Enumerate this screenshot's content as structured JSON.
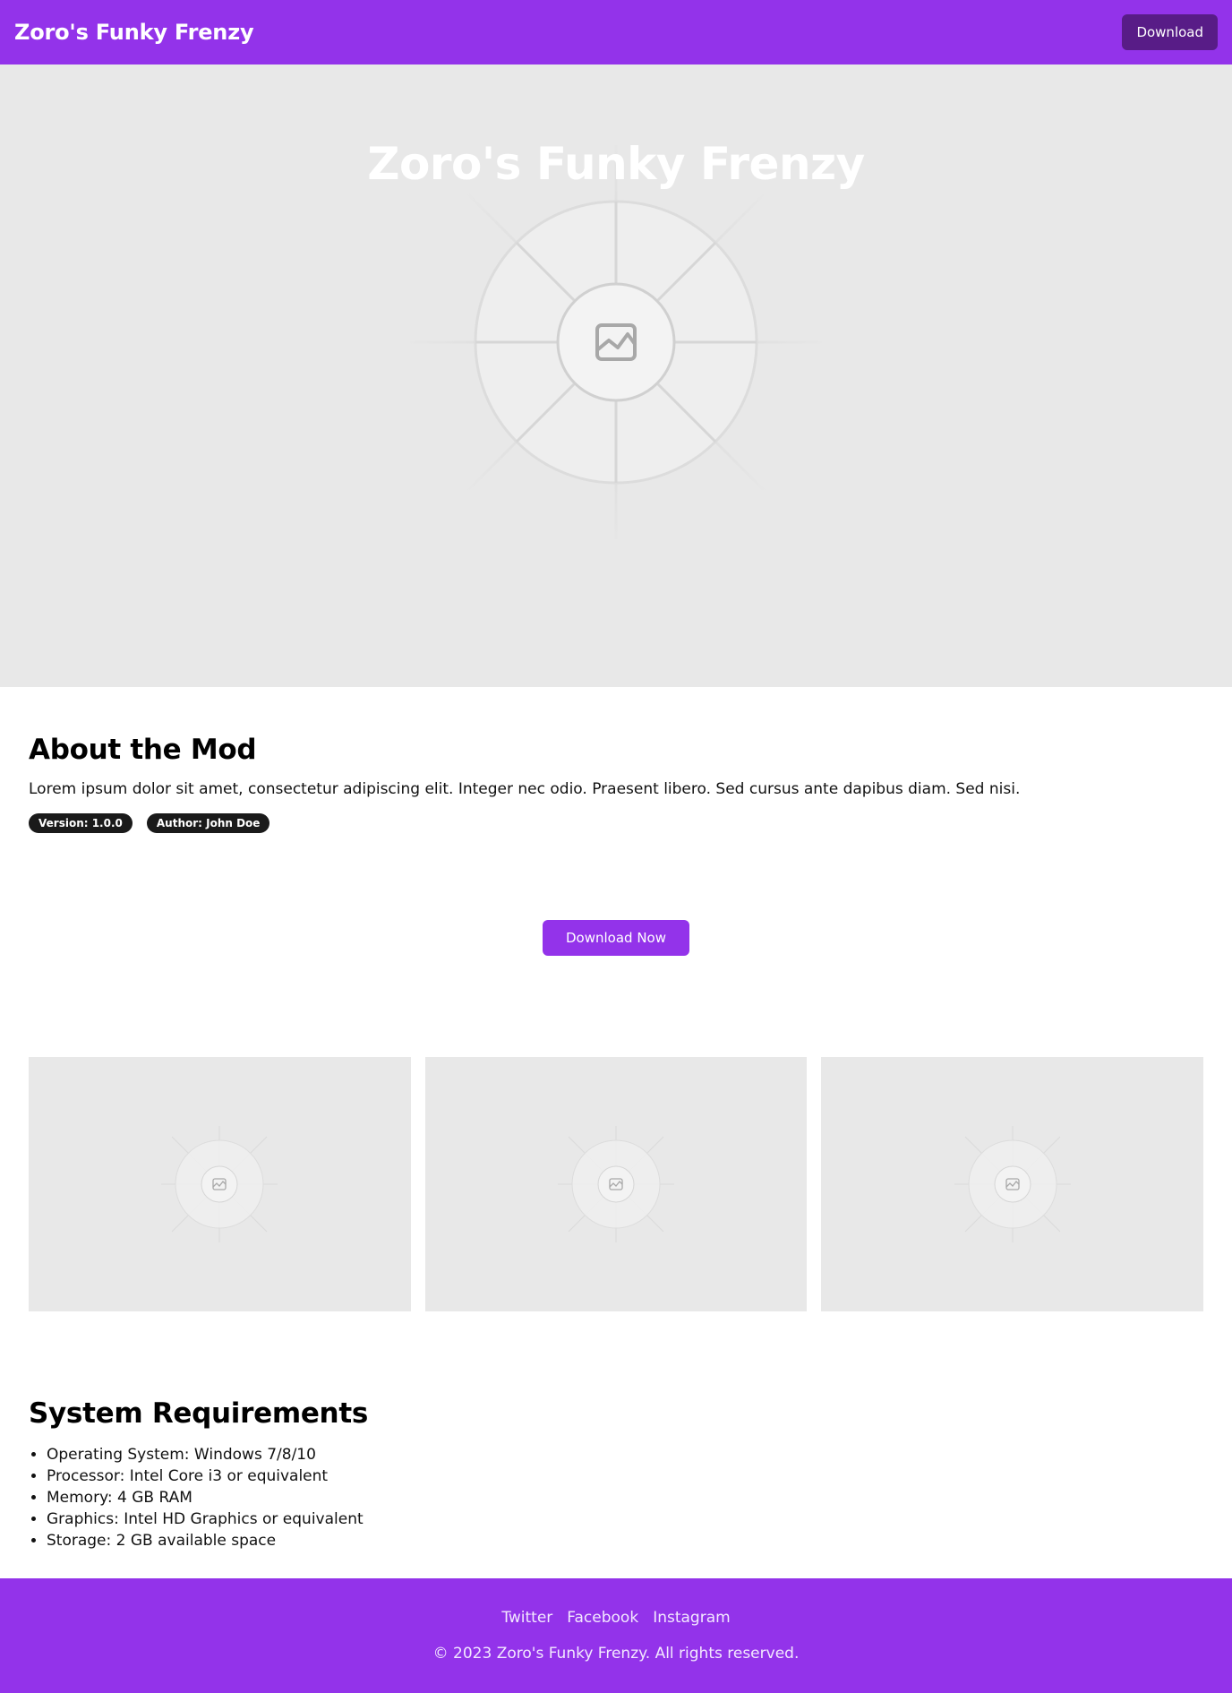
{
  "header": {
    "brand": "Zoro's Funky Frenzy",
    "download_label": "Download"
  },
  "hero": {
    "title": "Zoro's Funky Frenzy",
    "image_icon": "image-placeholder-icon"
  },
  "about": {
    "heading": "About the Mod",
    "description": "Lorem ipsum dolor sit amet, consectetur adipiscing elit. Integer nec odio. Praesent libero. Sed cursus ante dapibus diam. Sed nisi.",
    "badges": [
      "Version: 1.0.0",
      "Author: John Doe"
    ]
  },
  "cta": {
    "label": "Download Now"
  },
  "gallery": {
    "image_icon": "image-placeholder-icon"
  },
  "requirements": {
    "heading": "System Requirements",
    "items": [
      "Operating System: Windows 7/8/10",
      "Processor: Intel Core i3 or equivalent",
      "Memory: 4 GB RAM",
      "Graphics: Intel HD Graphics or equivalent",
      "Storage: 2 GB available space"
    ]
  },
  "footer": {
    "links": [
      "Twitter",
      "Facebook",
      "Instagram"
    ],
    "copyright": "© 2023 Zoro's Funky Frenzy. All rights reserved."
  },
  "colors": {
    "primary": "#9333ea",
    "primary_dark": "#581c87",
    "placeholder_bg": "#e8e8e8"
  }
}
